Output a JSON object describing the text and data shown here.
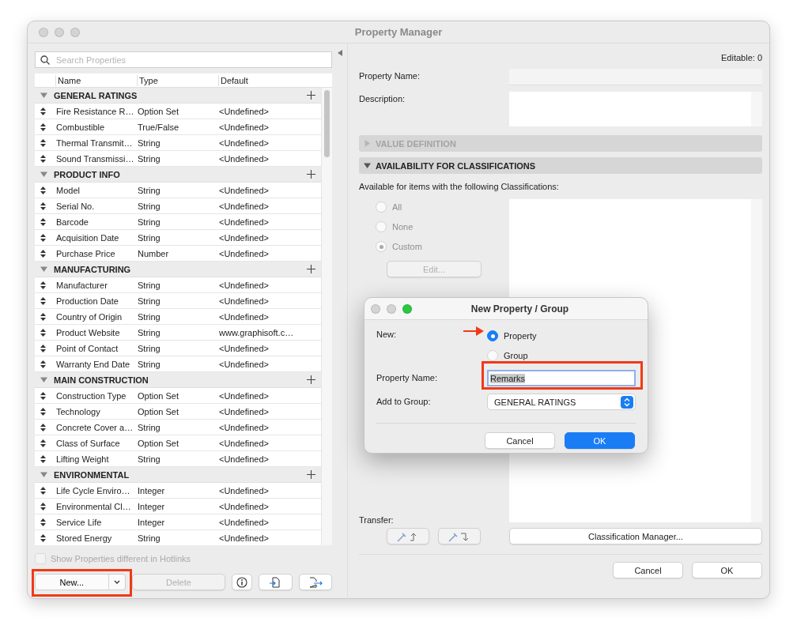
{
  "window": {
    "title": "Property Manager"
  },
  "search": {
    "placeholder": "Search Properties"
  },
  "table": {
    "columns": [
      "Name",
      "Type",
      "Default"
    ],
    "groups": [
      {
        "name": "GENERAL RATINGS",
        "expanded": true,
        "rows": [
          {
            "name": "Fire Resistance R…",
            "type": "Option Set",
            "default": "<Undefined>"
          },
          {
            "name": "Combustible",
            "type": "True/False",
            "default": "<Undefined>"
          },
          {
            "name": "Thermal Transmit…",
            "type": "String",
            "default": "<Undefined>"
          },
          {
            "name": "Sound Transmissi…",
            "type": "String",
            "default": "<Undefined>"
          }
        ]
      },
      {
        "name": "PRODUCT INFO",
        "expanded": true,
        "rows": [
          {
            "name": "Model",
            "type": "String",
            "default": "<Undefined>"
          },
          {
            "name": "Serial No.",
            "type": "String",
            "default": "<Undefined>"
          },
          {
            "name": "Barcode",
            "type": "String",
            "default": "<Undefined>"
          },
          {
            "name": "Acquisition Date",
            "type": "String",
            "default": "<Undefined>"
          },
          {
            "name": "Purchase Price",
            "type": "Number",
            "default": "<Undefined>"
          }
        ]
      },
      {
        "name": "MANUFACTURING",
        "expanded": true,
        "rows": [
          {
            "name": "Manufacturer",
            "type": "String",
            "default": "<Undefined>"
          },
          {
            "name": "Production Date",
            "type": "String",
            "default": "<Undefined>"
          },
          {
            "name": "Country of Origin",
            "type": "String",
            "default": "<Undefined>"
          },
          {
            "name": "Product Website",
            "type": "String",
            "default": "www.graphisoft.c…"
          },
          {
            "name": "Point of Contact",
            "type": "String",
            "default": "<Undefined>"
          },
          {
            "name": "Warranty End Date",
            "type": "String",
            "default": "<Undefined>"
          }
        ]
      },
      {
        "name": "MAIN CONSTRUCTION",
        "expanded": true,
        "rows": [
          {
            "name": "Construction Type",
            "type": "Option Set",
            "default": "<Undefined>"
          },
          {
            "name": "Technology",
            "type": "Option Set",
            "default": "<Undefined>"
          },
          {
            "name": "Concrete Cover a…",
            "type": "String",
            "default": "<Undefined>"
          },
          {
            "name": "Class of Surface",
            "type": "Option Set",
            "default": "<Undefined>"
          },
          {
            "name": "Lifting Weight",
            "type": "String",
            "default": "<Undefined>"
          }
        ]
      },
      {
        "name": "ENVIRONMENTAL",
        "expanded": true,
        "rows": [
          {
            "name": "Life Cycle Enviro…",
            "type": "Integer",
            "default": "<Undefined>"
          },
          {
            "name": "Environmental Cl…",
            "type": "Integer",
            "default": "<Undefined>"
          },
          {
            "name": "Service Life",
            "type": "Integer",
            "default": "<Undefined>"
          },
          {
            "name": "Stored Energy",
            "type": "String",
            "default": "<Undefined>"
          }
        ]
      }
    ]
  },
  "hotlinks_checkbox": {
    "label": "Show Properties different in Hotlinks",
    "checked": false,
    "disabled": true
  },
  "left_buttons": {
    "new": "New...",
    "delete": "Delete"
  },
  "editable": "Editable: 0",
  "property_name_label": "Property Name:",
  "description_label": "Description:",
  "sections": [
    {
      "title": "VALUE DEFINITION",
      "expanded": false,
      "disabled": true
    },
    {
      "title": "AVAILABILITY FOR CLASSIFICATIONS",
      "expanded": true,
      "disabled": false
    }
  ],
  "availability_text": "Available for items with the following Classifications:",
  "availability_options": [
    {
      "label": "All",
      "selected": false
    },
    {
      "label": "None",
      "selected": false
    },
    {
      "label": "Custom",
      "selected": true
    }
  ],
  "edit_button": "Edit...",
  "transfer_label": "Transfer:",
  "classification_manager_button": "Classification Manager...",
  "footer_buttons": [
    {
      "label": "Cancel"
    },
    {
      "label": "OK"
    }
  ],
  "dialog": {
    "title": "New Property / Group",
    "new_label": "New:",
    "options": [
      {
        "label": "Property",
        "selected": true
      },
      {
        "label": "Group",
        "selected": false
      }
    ],
    "property_name_label": "Property Name:",
    "property_name_value": "Remarks",
    "group_label": "Add to Group:",
    "group_value": "GENERAL RATINGS",
    "buttons": [
      {
        "label": "Cancel",
        "kind": "secondary"
      },
      {
        "label": "OK",
        "kind": "primary"
      }
    ]
  }
}
